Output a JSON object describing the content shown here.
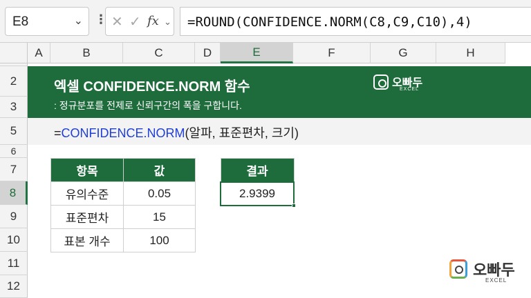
{
  "formula_bar": {
    "name_box": "E8",
    "cancel_icon": "✕",
    "enter_icon": "✓",
    "fx_label": "fx",
    "formula": "=ROUND(CONFIDENCE.NORM(C8,C9,C10),4)"
  },
  "columns": [
    "A",
    "B",
    "C",
    "D",
    "E",
    "F",
    "G",
    "H"
  ],
  "selected_column": "E",
  "rows": [
    "2",
    "3",
    "5",
    "6",
    "7",
    "8",
    "9",
    "10",
    "11",
    "12"
  ],
  "selected_row": "8",
  "banner": {
    "title": "엑셀 CONFIDENCE.NORM 함수",
    "subtitle": ": 정규분포를 전제로 신뢰구간의 폭을 구합니다.",
    "brand_name": "오빠두",
    "brand_sub": "EXCEL"
  },
  "syntax": {
    "eq": "=",
    "function": "CONFIDENCE.NORM",
    "args": "(알파, 표준편차, 크기)"
  },
  "input_table": {
    "headers": [
      "항목",
      "값"
    ],
    "rows": [
      [
        "유의수준",
        "0.05"
      ],
      [
        "표준편차",
        "15"
      ],
      [
        "표본 개수",
        "100"
      ]
    ]
  },
  "result_table": {
    "header": "결과",
    "value": "2.9399"
  },
  "logo": {
    "name": "오빠두",
    "sub": "EXCEL"
  },
  "colors": {
    "excel_green": "#1e6b3c",
    "function_blue": "#1f3fd6"
  }
}
